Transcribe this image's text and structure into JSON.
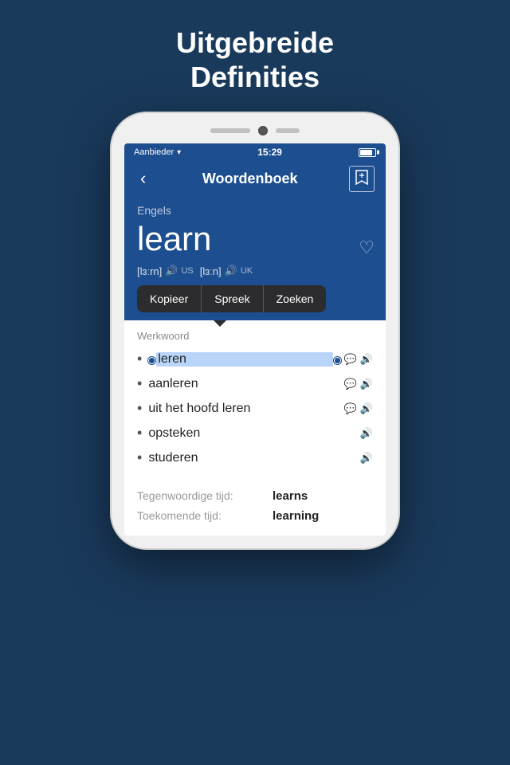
{
  "page": {
    "title_line1": "Uitgebreide",
    "title_line2": "Definities"
  },
  "status_bar": {
    "carrier": "Aanbieder",
    "time": "15:29"
  },
  "nav": {
    "back_icon": "‹",
    "title": "Woordenboek",
    "bookmark_icon": "⊠"
  },
  "word": {
    "language": "Engels",
    "word": "learn",
    "phonetic_us": "[lɜːrn]",
    "phonetic_uk": "[lɜːn]",
    "label_us": "US",
    "label_uk": "UK"
  },
  "context_menu": {
    "items": [
      "Kopieer",
      "Spreek",
      "Zoeken"
    ]
  },
  "definitions": {
    "pos": "Werkwoord",
    "items": [
      {
        "text": "leren",
        "highlighted": true,
        "has_comment": true,
        "has_sound": true
      },
      {
        "text": "aanleren",
        "highlighted": false,
        "has_comment": true,
        "has_sound": true
      },
      {
        "text": "uit het hoofd leren",
        "highlighted": false,
        "has_comment": true,
        "has_sound": true
      },
      {
        "text": "opsteken",
        "highlighted": false,
        "has_comment": false,
        "has_sound": true
      },
      {
        "text": "studeren",
        "highlighted": false,
        "has_comment": false,
        "has_sound": true
      }
    ]
  },
  "conjugation": {
    "rows": [
      {
        "label": "Tegenwoordige tijd:",
        "value": "learns"
      },
      {
        "label": "Toekomende tijd:",
        "value": "learning"
      }
    ]
  }
}
